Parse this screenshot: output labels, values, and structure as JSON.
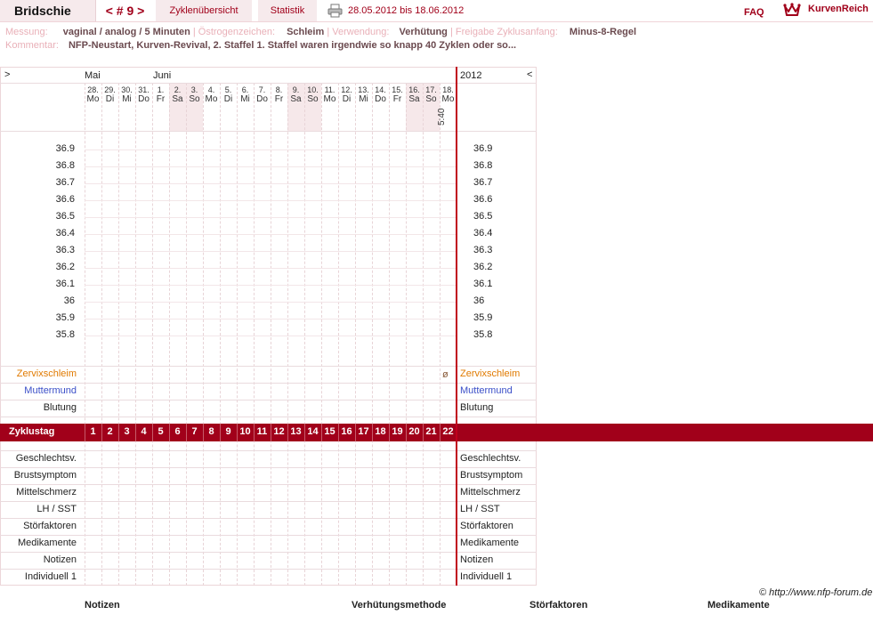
{
  "header": {
    "name": "Bridschie",
    "cycle_nav": "< # 9 >",
    "tabs": [
      "Zyklenübersicht",
      "Statistik"
    ],
    "date_range": "28.05.2012 bis 18.06.2012",
    "faq": "FAQ",
    "brand": "KurvenReich"
  },
  "info": {
    "messung_label": "Messung:",
    "messung_value": "vaginal / analog / 5 Minuten",
    "oestrogen_label": "Östrogenzeichen:",
    "oestrogen_value": "Schleim",
    "verwendung_label": "Verwendung:",
    "verwendung_value": "Verhütung",
    "freigabe_label": "Freigabe Zyklusanfang:",
    "freigabe_value": "Minus-8-Regel",
    "kommentar_label": "Kommentar:",
    "kommentar_value": "NFP-Neustart, Kurven-Revival, 2. Staffel 1. Staffel waren irgendwie so knapp 40 Zyklen oder so..."
  },
  "chart": {
    "nav_left": ">",
    "nav_right": "<",
    "year": "2012",
    "months": [
      "Mai",
      "Juni"
    ],
    "days": [
      {
        "num": "28.",
        "wd": "Mo",
        "weekend": false
      },
      {
        "num": "29.",
        "wd": "Di",
        "weekend": false
      },
      {
        "num": "30.",
        "wd": "Mi",
        "weekend": false
      },
      {
        "num": "31.",
        "wd": "Do",
        "weekend": false
      },
      {
        "num": "1.",
        "wd": "Fr",
        "weekend": false
      },
      {
        "num": "2.",
        "wd": "Sa",
        "weekend": true
      },
      {
        "num": "3.",
        "wd": "So",
        "weekend": true
      },
      {
        "num": "4.",
        "wd": "Mo",
        "weekend": false
      },
      {
        "num": "5.",
        "wd": "Di",
        "weekend": false
      },
      {
        "num": "6.",
        "wd": "Mi",
        "weekend": false
      },
      {
        "num": "7.",
        "wd": "Do",
        "weekend": false
      },
      {
        "num": "8.",
        "wd": "Fr",
        "weekend": false
      },
      {
        "num": "9.",
        "wd": "Sa",
        "weekend": true
      },
      {
        "num": "10.",
        "wd": "So",
        "weekend": true
      },
      {
        "num": "11.",
        "wd": "Mo",
        "weekend": false
      },
      {
        "num": "12.",
        "wd": "Di",
        "weekend": false
      },
      {
        "num": "13.",
        "wd": "Mi",
        "weekend": false
      },
      {
        "num": "14.",
        "wd": "Do",
        "weekend": false
      },
      {
        "num": "15.",
        "wd": "Fr",
        "weekend": false
      },
      {
        "num": "16.",
        "wd": "Sa",
        "weekend": true
      },
      {
        "num": "17.",
        "wd": "So",
        "weekend": true
      },
      {
        "num": "18.",
        "wd": "Mo",
        "weekend": false
      }
    ],
    "last_time": "5:40",
    "temperatures": [
      "36.9",
      "36.8",
      "36.7",
      "36.6",
      "36.5",
      "36.4",
      "36.3",
      "36.2",
      "36.1",
      "36",
      "35.9",
      "35.8"
    ],
    "row_zervix": "Zervixschleim",
    "row_muttermund": "Muttermund",
    "row_blutung": "Blutung",
    "zervix_mark": "ø",
    "zyklustag_label": "Zyklustag",
    "zyklustage": [
      "1",
      "2",
      "3",
      "4",
      "5",
      "6",
      "7",
      "8",
      "9",
      "10",
      "11",
      "12",
      "13",
      "14",
      "15",
      "16",
      "17",
      "18",
      "19",
      "20",
      "21",
      "22"
    ],
    "lower_rows": [
      "Geschlechtsv.",
      "Brustsymptom",
      "Mittelschmerz",
      "LH / SST",
      "Störfaktoren",
      "Medikamente",
      "Notizen",
      "Individuell 1"
    ]
  },
  "footer": {
    "copyright": "© http://www.nfp-forum.de",
    "cols": [
      "Notizen",
      "Verhütungsmethode",
      "Störfaktoren",
      "Medikamente"
    ]
  },
  "colors": {
    "accent": "#a1001a",
    "zervix": "#e07a00",
    "muttermund": "#3b4fc8"
  }
}
